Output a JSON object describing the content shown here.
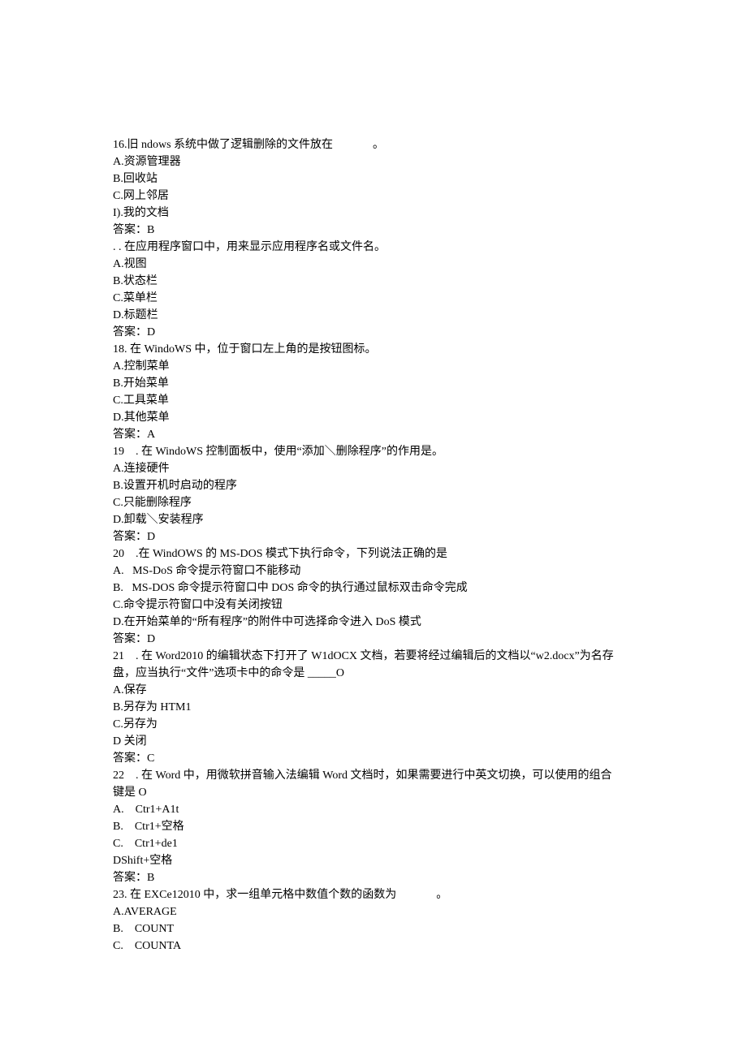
{
  "lines": [
    "16.旧 ndows 系统中做了逻辑删除的文件放在              。",
    "A.资源管理器",
    "B.回收站",
    "C.网上邻居",
    "I).我的文档",
    "答案：B",
    ". . 在应用程序窗口中，用来显示应用程序名或文件名。",
    "A.视图",
    "B.状态栏",
    "C.菜单栏",
    "D.标题栏",
    "答案：D",
    "18. 在 WindoWS 中，位于窗口左上角的是按钮图标。",
    "A.控制菜单",
    "B.开始菜单",
    "C.工具菜单",
    "D.其他菜单",
    "答案：A",
    "19    . 在 WindoWS 控制面板中，使用“添加＼删除程序”的作用是。",
    "A.连接硬件",
    "B.设置开机时启动的程序",
    "C.只能删除程序",
    "D.卸载＼安装程序",
    "答案：D",
    "20    .在 WindOWS 的 MS-DOS 模式下执行命令，下列说法正确的是",
    "A.   MS-DoS 命令提示符窗口不能移动",
    "B.   MS-DOS 命令提示符窗口中 DOS 命令的执行通过鼠标双击命令完成",
    "C.命令提示符窗口中没有关闭按钮",
    "D.在开始菜单的“所有程序”的附件中可选择命令进入 DoS 模式",
    "答案：D",
    "21    . 在 Word2010 的编辑状态下打开了 W1dOCX 文档，若要将经过编辑后的文档以“w2.docx”为名存盘，应当执行“文件”选项卡中的命令是 _____O",
    "A.保存",
    "B.另存为 HTM1",
    "C.另存为",
    "D 关闭",
    "答案：C",
    "22    . 在 Word 中，用微软拼音输入法编辑 Word 文档时，如果需要进行中英文切换，可以使用的组合",
    "键是 O",
    "A.    Ctr1+A1t",
    "B.    Ctr1+空格",
    "C.    Ctr1+de1",
    "DShift+空格",
    "答案：B",
    "23. 在 EXCe12010 中，求一组单元格中数值个数的函数为              。",
    "A.AVERAGE",
    "B.    COUNT",
    "C.    COUNTA"
  ]
}
